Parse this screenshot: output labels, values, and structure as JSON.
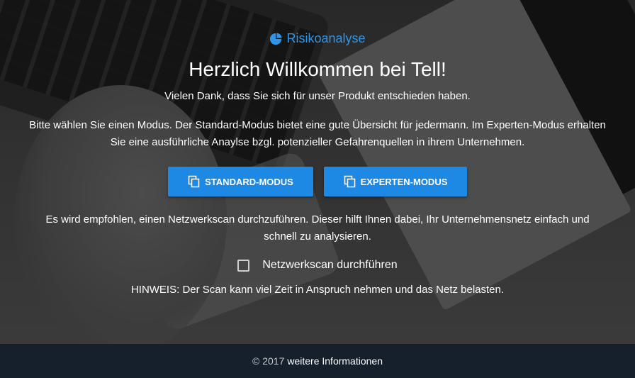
{
  "brand": {
    "icon": "pie-chart-icon",
    "name": "Risikoanalyse",
    "color": "#2f95e8"
  },
  "heading": "Herzlich Willkommen bei Tell!",
  "intro": "Vielen Dank, dass Sie sich für unser Produkt entschieden haben.",
  "mode_text": "Bitte wählen Sie einen Modus. Der Standard-Modus bietet eine gute Übersicht für jedermann. Im Experten-Modus erhalten Sie eine ausführliche Anaylse bzgl. potenzieller Gefahrenquellen in ihrem Unternehmen.",
  "buttons": {
    "standard": {
      "label": "STANDARD-MODUS",
      "icon": "copy-icon"
    },
    "expert": {
      "label": "EXPERTEN-MODUS",
      "icon": "copy-icon"
    },
    "color": "#1e88e5"
  },
  "scan_text": "Es wird empfohlen, einen Netzwerkscan durchzuführen. Dieser hilft Ihnen dabei, Ihr Unternehmensnetz einfach und schnell zu analysieren.",
  "checkbox": {
    "label": "Netzwerkscan durchführen",
    "checked": false
  },
  "hint": "HINWEIS: Der Scan kann viel Zeit in Anspruch nehmen und das Netz belasten.",
  "footer": {
    "copyright": "© 2017",
    "link": "weitere Informationen"
  }
}
